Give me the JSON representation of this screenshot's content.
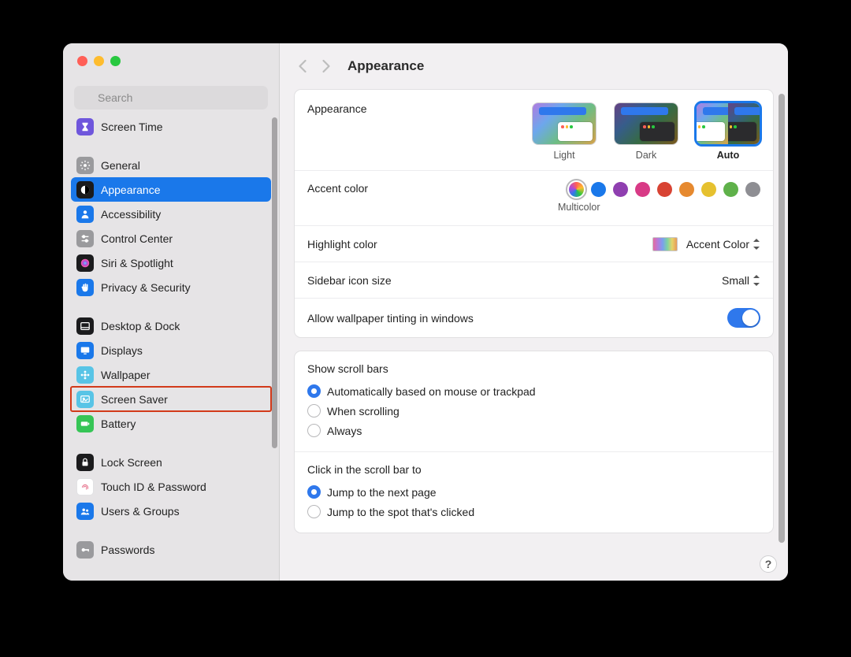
{
  "window": {
    "title": "Appearance"
  },
  "search": {
    "placeholder": "Search"
  },
  "sidebar": {
    "items": [
      {
        "label": "Screen Time",
        "icon_bg": "#6f56dc",
        "icon": "hourglass"
      },
      {
        "label": "General",
        "icon_bg": "#9a9a9d",
        "icon": "gear"
      },
      {
        "label": "Appearance",
        "icon_bg": "#1b1b1d",
        "icon": "contrast",
        "selected": true
      },
      {
        "label": "Accessibility",
        "icon_bg": "#1a78ea",
        "icon": "person"
      },
      {
        "label": "Control Center",
        "icon_bg": "#9a9a9d",
        "icon": "sliders"
      },
      {
        "label": "Siri & Spotlight",
        "icon_bg": "#1b1b1d",
        "icon": "siri"
      },
      {
        "label": "Privacy & Security",
        "icon_bg": "#1a78ea",
        "icon": "hand"
      },
      {
        "label": "Desktop & Dock",
        "icon_bg": "#1b1b1d",
        "icon": "dock"
      },
      {
        "label": "Displays",
        "icon_bg": "#1a78ea",
        "icon": "display"
      },
      {
        "label": "Wallpaper",
        "icon_bg": "#58c4e6",
        "icon": "flower"
      },
      {
        "label": "Screen Saver",
        "icon_bg": "#58c4e6",
        "icon": "screensaver",
        "highlighted": true
      },
      {
        "label": "Battery",
        "icon_bg": "#36c556",
        "icon": "battery"
      },
      {
        "label": "Lock Screen",
        "icon_bg": "#1b1b1d",
        "icon": "lock"
      },
      {
        "label": "Touch ID & Password",
        "icon_bg": "#ffffff",
        "icon": "fingerprint"
      },
      {
        "label": "Users & Groups",
        "icon_bg": "#1a78ea",
        "icon": "users"
      },
      {
        "label": "Passwords",
        "icon_bg": "#9a9a9d",
        "icon": "key"
      }
    ]
  },
  "appearance": {
    "section_label": "Appearance",
    "modes": [
      {
        "label": "Light"
      },
      {
        "label": "Dark"
      },
      {
        "label": "Auto",
        "selected": true
      }
    ],
    "accent": {
      "label": "Accent color",
      "selected_label": "Multicolor",
      "colors": [
        {
          "name": "multicolor",
          "css": "conic-gradient(#ff5f57,#febc2e,#28c840,#2f78ec,#b047d8,#ff5f57)",
          "selected": true
        },
        {
          "name": "blue",
          "css": "#1a78ea"
        },
        {
          "name": "purple",
          "css": "#8f3fb0"
        },
        {
          "name": "pink",
          "css": "#d83a86"
        },
        {
          "name": "red",
          "css": "#d84333"
        },
        {
          "name": "orange",
          "css": "#e6892f"
        },
        {
          "name": "yellow",
          "css": "#e6c12f"
        },
        {
          "name": "green",
          "css": "#5fb14a"
        },
        {
          "name": "graphite",
          "css": "#8e8e93"
        }
      ]
    },
    "highlight": {
      "label": "Highlight color",
      "value": "Accent Color"
    },
    "sidebar_size": {
      "label": "Sidebar icon size",
      "value": "Small"
    },
    "wallpaper_tint": {
      "label": "Allow wallpaper tinting in windows",
      "value": true
    },
    "scrollbars": {
      "title": "Show scroll bars",
      "options": [
        {
          "label": "Automatically based on mouse or trackpad",
          "checked": true
        },
        {
          "label": "When scrolling"
        },
        {
          "label": "Always"
        }
      ]
    },
    "click_scroll": {
      "title": "Click in the scroll bar to",
      "options": [
        {
          "label": "Jump to the next page",
          "checked": true
        },
        {
          "label": "Jump to the spot that's clicked"
        }
      ]
    }
  },
  "help_label": "?"
}
